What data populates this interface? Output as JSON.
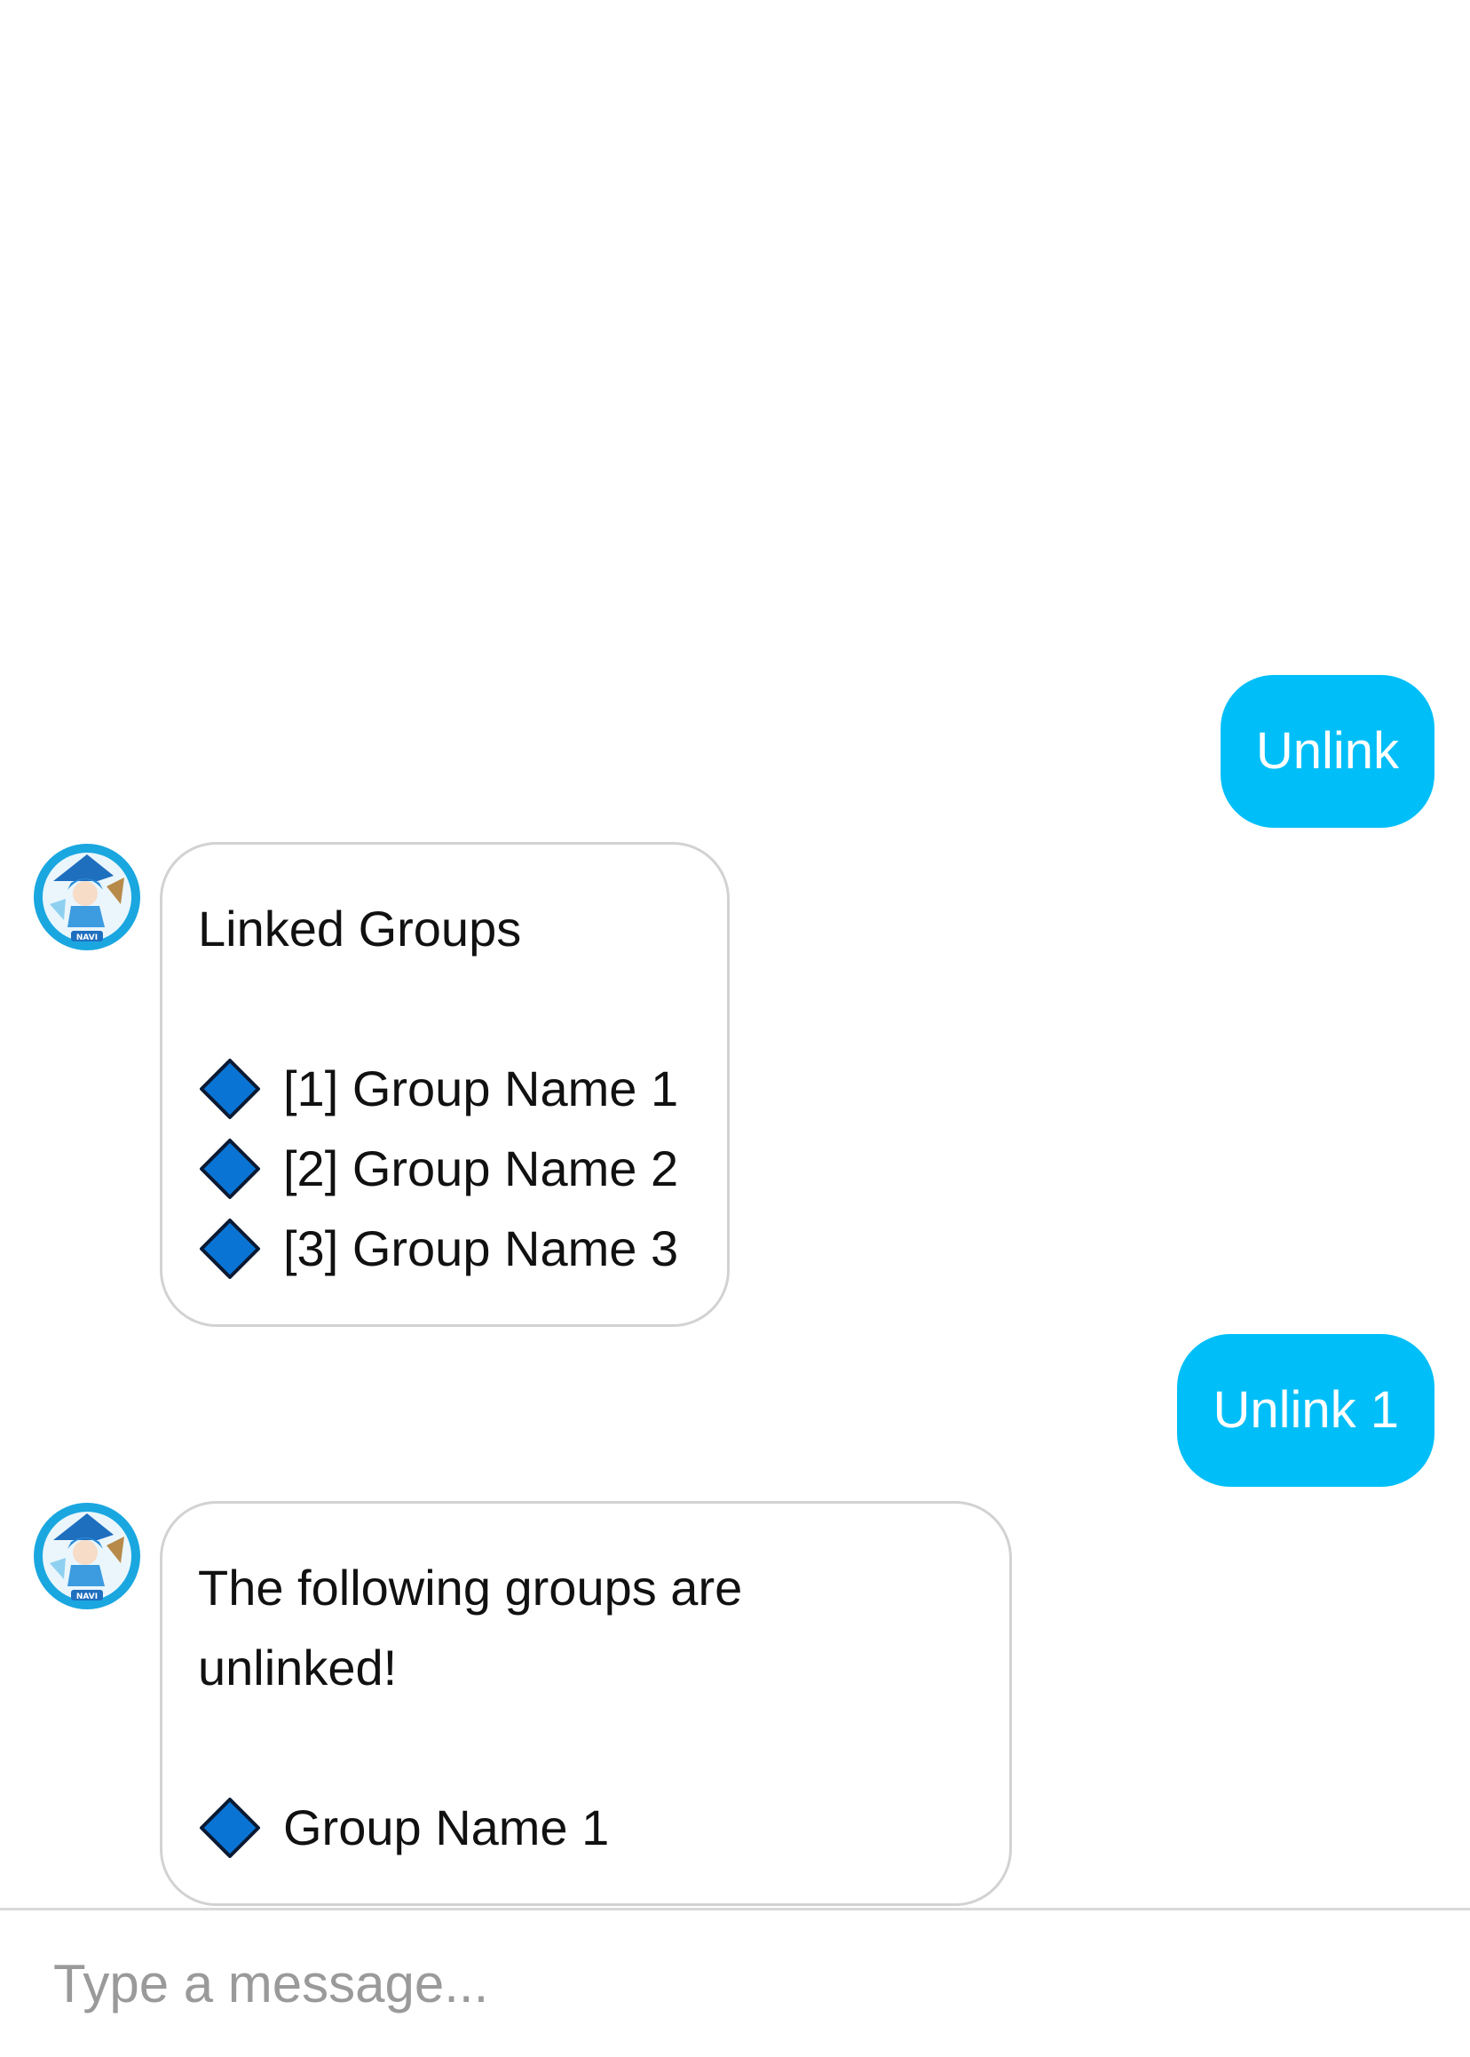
{
  "colors": {
    "user_bubble": "#00bff8",
    "user_text": "#ffffff",
    "bot_border": "#d2d2d2",
    "diamond_fill": "#0a74d4",
    "diamond_stroke": "#0b1a33",
    "avatar_ring": "#1aa7e0"
  },
  "bot": {
    "avatar_icon": "navi-character-avatar",
    "avatar_label": "NAVI"
  },
  "messages": {
    "m1": {
      "sender": "user",
      "text": "Unlink"
    },
    "m2": {
      "sender": "bot",
      "title": "Linked Groups",
      "items": [
        {
          "icon": "blue-diamond-icon",
          "text": "[1] Group Name 1"
        },
        {
          "icon": "blue-diamond-icon",
          "text": "[2] Group Name 2"
        },
        {
          "icon": "blue-diamond-icon",
          "text": "[3] Group Name 3"
        }
      ]
    },
    "m3": {
      "sender": "user",
      "text": "Unlink 1"
    },
    "m4": {
      "sender": "bot",
      "line1": "The following groups are",
      "line2": "unlinked!",
      "items": [
        {
          "icon": "blue-diamond-icon",
          "text": "Group Name 1"
        }
      ]
    }
  },
  "composer": {
    "placeholder": "Type a message...",
    "value": ""
  }
}
